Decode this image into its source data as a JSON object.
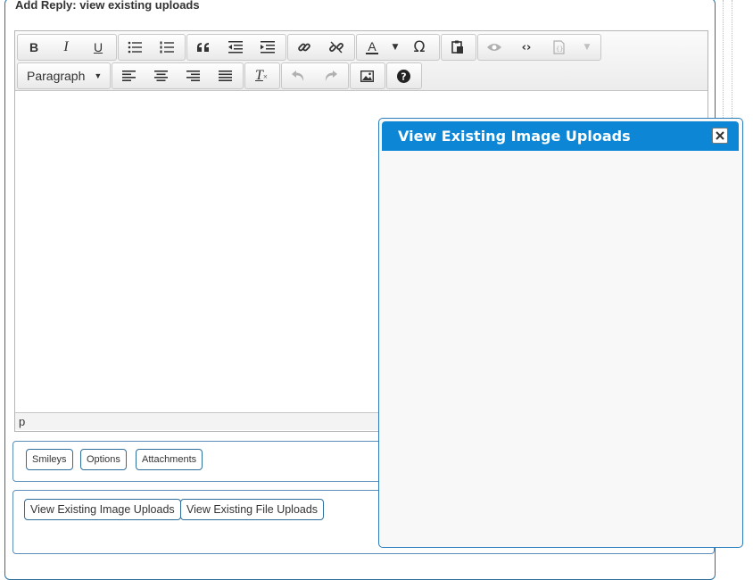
{
  "form": {
    "legend": "Add Reply: view existing uploads"
  },
  "toolbar": {
    "format_label": "Paragraph",
    "row1_icons": [
      "bold-icon",
      "italic-icon",
      "underline-icon",
      "bullet-list-icon",
      "numbered-list-icon",
      "blockquote-icon",
      "outdent-icon",
      "indent-icon",
      "link-icon",
      "unlink-icon",
      "text-color-icon",
      "special-char-icon",
      "paste-icon",
      "preview-icon",
      "code-icon",
      "template-icon"
    ],
    "row2_icons": [
      "align-left-icon",
      "align-center-icon",
      "align-right-icon",
      "align-justify-icon",
      "clear-format-icon",
      "undo-icon",
      "redo-icon",
      "image-icon",
      "help-icon"
    ],
    "bold": "B",
    "italic": "I",
    "underline": "U",
    "text_color": "A",
    "omega": "Ω",
    "clear_format": "T"
  },
  "status": {
    "path": "p"
  },
  "options_bar": {
    "smileys": "Smileys",
    "options": "Options",
    "attachments": "Attachments"
  },
  "uploads_bar": {
    "images": "View Existing Image Uploads",
    "files": "View Existing File Uploads"
  },
  "dialog": {
    "title": "View Existing Image Uploads"
  },
  "colors": {
    "dialog_header": "#0d86d6",
    "border_accent": "#2e6f9e"
  }
}
